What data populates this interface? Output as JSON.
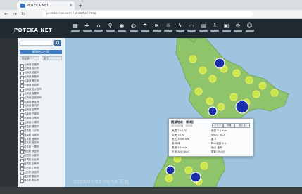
{
  "browser": {
    "tab_title": "POTEKA NET",
    "tab_close": "×",
    "new_tab": "+",
    "back": "←",
    "forward": "→",
    "reload": "↻",
    "url": "poteka-net.com  /  weather map",
    "icons": {
      "favicon": "globe-icon"
    }
  },
  "app": {
    "logo": "POTEKA NET",
    "toolbar": [
      {
        "icon": "map-icon",
        "glyph": "▦"
      },
      {
        "icon": "pin-icon",
        "glyph": "✚"
      },
      {
        "icon": "home-icon",
        "glyph": "⌂"
      },
      {
        "icon": "temperature-icon",
        "glyph": "⚲"
      },
      {
        "icon": "humidity-icon",
        "glyph": "◉"
      },
      {
        "icon": "pressure-icon",
        "glyph": "◎"
      },
      {
        "icon": "rain-icon",
        "glyph": "☂"
      },
      {
        "icon": "wind-icon",
        "glyph": "≋"
      },
      {
        "icon": "solar-icon",
        "glyph": "☼"
      },
      {
        "icon": "lightning-icon",
        "glyph": "ϟ"
      },
      {
        "icon": "wbgt-icon",
        "glyph": "▭"
      },
      {
        "icon": "chart-icon",
        "glyph": "▤"
      },
      {
        "icon": "download-icon",
        "glyph": "⇩"
      },
      {
        "icon": "camera-icon",
        "glyph": "▣"
      },
      {
        "icon": "settings-icon",
        "glyph": "⚙"
      },
      {
        "icon": "user-icon",
        "glyph": "☺"
      }
    ]
  },
  "sidebar": {
    "search_button": "Q",
    "header": "観測地点一覧",
    "filter_a": "地点名",
    "filter_b": "全て",
    "stations": [
      "北海道 札幌市",
      "北海道 旭川市",
      "北海道 函館市",
      "北海道 釧路市",
      "北海道 帯広市",
      "北海道 北見市",
      "北海道 苫小牧市",
      "北海道 室蘭市",
      "北海道 岩見沢市",
      "北海道 網走市",
      "北海道 稚内市",
      "北海道 名寄市",
      "北海道 千歳市",
      "北海道 江別市",
      "北海道 小樽市",
      "青森県 青森市",
      "青森県 八戸市",
      "青森県 弘前市",
      "岩手県 盛岡市",
      "岩手県 宮古市",
      "岩手県 一関市",
      "秋田県 秋田市",
      "秋田県 大館市",
      "宮城県 仙台市",
      "宮城県 石巻市",
      "山形県 山形市",
      "山形県 酒田市",
      "福島県 福島市",
      "福島県 郡山市"
    ]
  },
  "popup": {
    "title": "観測地点  （詳細）",
    "subtitle": "2023/07/11 09:59",
    "buttons": [
      "グラフ",
      "詳細",
      "閉じる"
    ],
    "fields_left": [
      "気温 23.5 ℃",
      "湿度 78 %",
      "気圧 1006 hPa",
      "風向 南",
      "風速 2.1 m/s",
      "日射 420 W/㎡"
    ],
    "fields_right": [
      "雨量 0.0 mm",
      "WBGT 24.1",
      "雷 0",
      "降水強度 0.0",
      "地点 番号",
      "更新 09:59"
    ]
  },
  "map": {
    "timestamp": "2023/07/11 09:59  天気"
  }
}
